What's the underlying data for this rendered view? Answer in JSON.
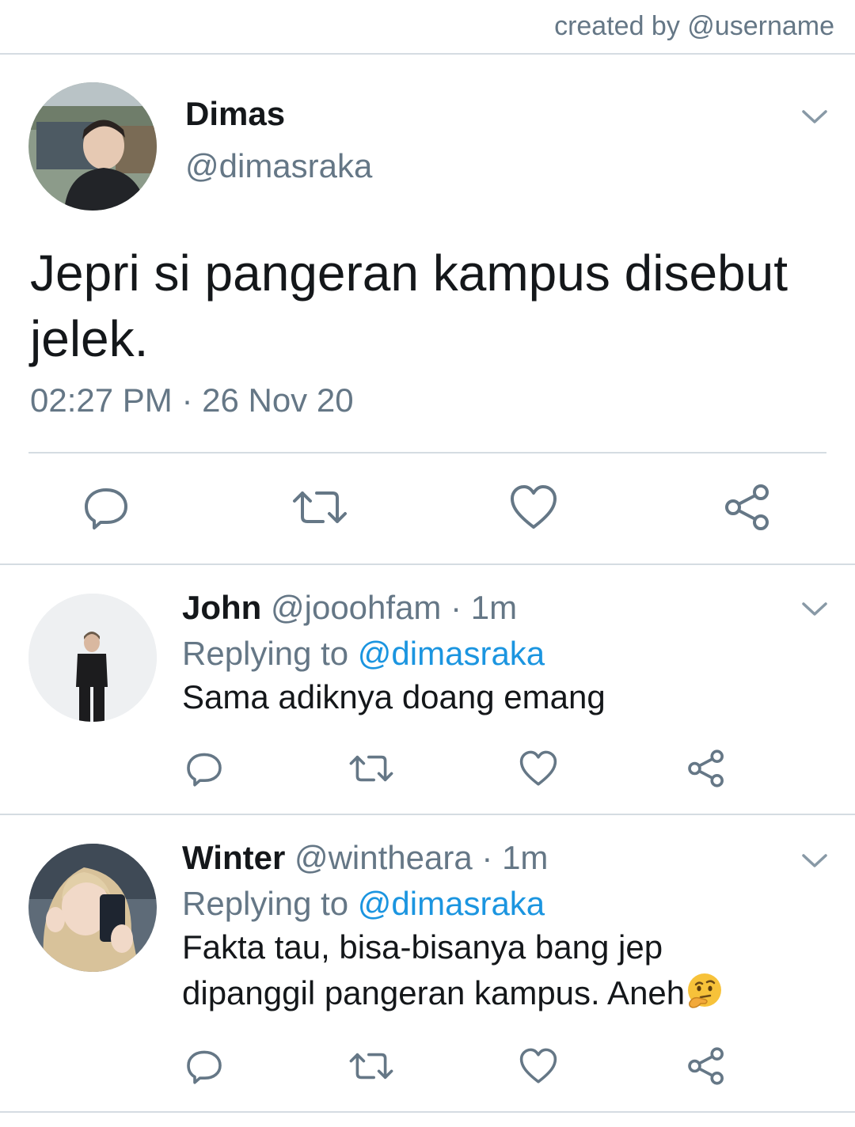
{
  "credit": "created by @username",
  "main_tweet": {
    "name": "Dimas",
    "handle": "@dimasraka",
    "text": "Jepri si pangeran kampus disebut jelek.",
    "timestamp": "02:27 PM · 26 Nov 20",
    "icons": [
      "reply-icon",
      "retweet-icon",
      "like-icon",
      "share-icon"
    ]
  },
  "replies": [
    {
      "name": "John",
      "handle": "@jooohfam",
      "sep": "·",
      "time": "1m",
      "replying_label": "Replying to",
      "replying_to": "@dimasraka",
      "text": "Sama adiknya doang emang"
    },
    {
      "name": "Winter",
      "handle": "@wintheara",
      "sep": "·",
      "time": "1m",
      "replying_label": "Replying to",
      "replying_to": "@dimasraka",
      "text_line1": "Fakta tau, bisa-bisanya bang jep",
      "text_line2": "dipanggil pangeran kampus. Aneh",
      "emoji": "thinking-face-emoji"
    }
  ],
  "colors": {
    "text": "#14171a",
    "muted": "#657786",
    "link": "#1b95e0",
    "divider": "#d5dce2"
  }
}
